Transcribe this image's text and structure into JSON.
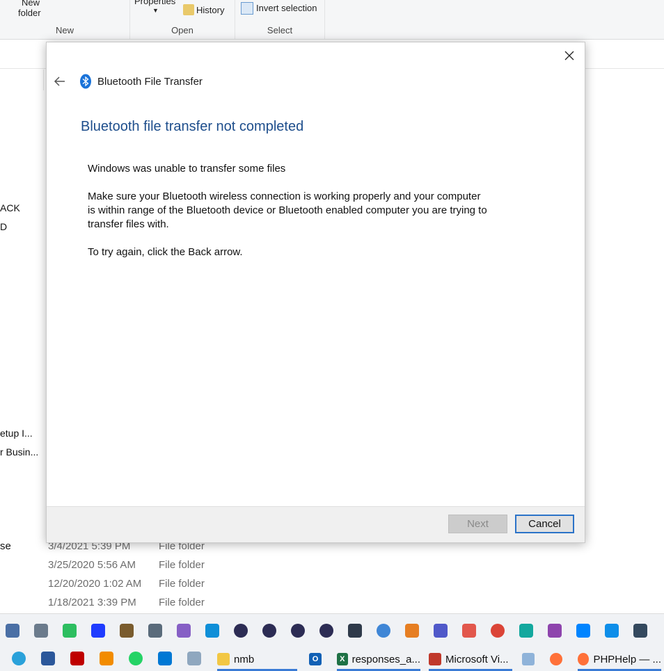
{
  "ribbon": {
    "new_folder_line1": "New",
    "new_folder_line2": "folder",
    "group_new": "New",
    "properties_label": "Properties",
    "history_label": "History",
    "group_open": "Open",
    "invert_selection_label": "Invert selection",
    "group_select": "Select"
  },
  "nav_fragments": [
    "ACK",
    "D",
    "etup I...",
    "r Busin..."
  ],
  "file_list": {
    "left_fragment": "se",
    "rows": [
      {
        "date": "3/4/2021 5:39 PM",
        "type": "File folder"
      },
      {
        "date": "3/25/2020 5:56 AM",
        "type": "File folder"
      },
      {
        "date": "12/20/2020 1:02 AM",
        "type": "File folder"
      },
      {
        "date": "1/18/2021 3:39 PM",
        "type": "File folder"
      }
    ]
  },
  "dialog": {
    "window_title": "Bluetooth File Transfer",
    "heading": "Bluetooth file transfer not completed",
    "message1": "Windows was unable to transfer some files",
    "message2": "Make sure your Bluetooth wireless connection is working properly and your computer is within range of the Bluetooth device or Bluetooth enabled computer you are trying to transfer files with.",
    "message3": "To try again, click the Back arrow.",
    "next_label": "Next",
    "cancel_label": "Cancel",
    "accent_color": "#1e4e8c",
    "icons": [
      "back-arrow-icon",
      "bluetooth-icon",
      "close-icon"
    ]
  },
  "taskbar": {
    "tray_icons": [
      "screenshot-icon",
      "camera-icon",
      "evernote-icon",
      "malwarebytes-icon",
      "ultraedit-icon",
      "settings-app-icon",
      "visual-studio-icon",
      "edge-icon",
      "eclipse-icon",
      "eclipse-icon",
      "eclipse-icon",
      "eclipse-icon",
      "github-icon",
      "safari-icon",
      "gear-app-icon",
      "teams-icon",
      "git-icon",
      "chrome-icon",
      "app-icon",
      "app-icon",
      "messenger-icon",
      "teamviewer-icon",
      "app-icon"
    ],
    "pinned": [
      "telegram-icon",
      "word-icon",
      "filezilla-icon",
      "vlc-icon",
      "whatsapp-icon",
      "vscode-icon",
      "app-icon"
    ],
    "items": [
      {
        "label": "nmb",
        "icon": "folder-icon"
      },
      {
        "label": "",
        "icon": "outlook-icon"
      },
      {
        "label": "responses_a...",
        "icon": "excel-icon"
      },
      {
        "label": "Microsoft Vi...",
        "icon": "app-window-icon"
      },
      {
        "label": "",
        "icon": "paint-icon"
      },
      {
        "label": "",
        "icon": "firefox-icon"
      },
      {
        "label": "PHPHelp — ...",
        "icon": "firefox-icon"
      }
    ]
  }
}
